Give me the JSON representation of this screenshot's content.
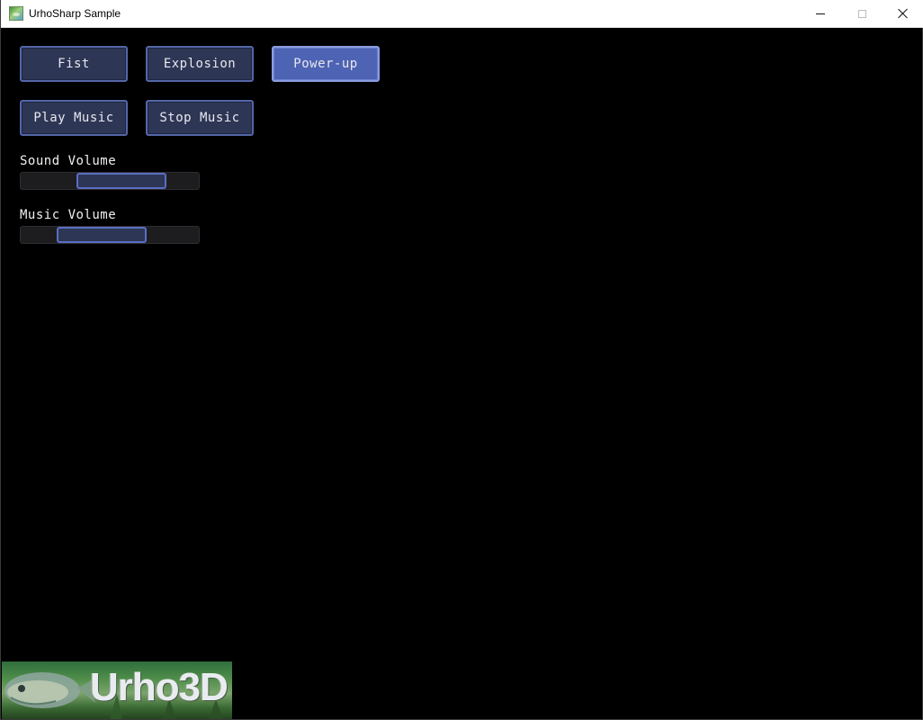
{
  "window": {
    "title": "UrhoSharp Sample"
  },
  "buttons": {
    "fist": "Fist",
    "explosion": "Explosion",
    "powerup": "Power-up",
    "play_music": "Play Music",
    "stop_music": "Stop Music"
  },
  "sliders": {
    "sound": {
      "label": "Sound Volume",
      "value": 0.63
    },
    "music": {
      "label": "Music Volume",
      "value": 0.41
    }
  },
  "logo": {
    "text": "Urho3D"
  },
  "colors": {
    "button_bg": "#2d3654",
    "button_border": "#5566a8",
    "button_active_bg": "#4d63b3",
    "slider_knob_border": "#5b6ec2",
    "background": "#000000"
  }
}
